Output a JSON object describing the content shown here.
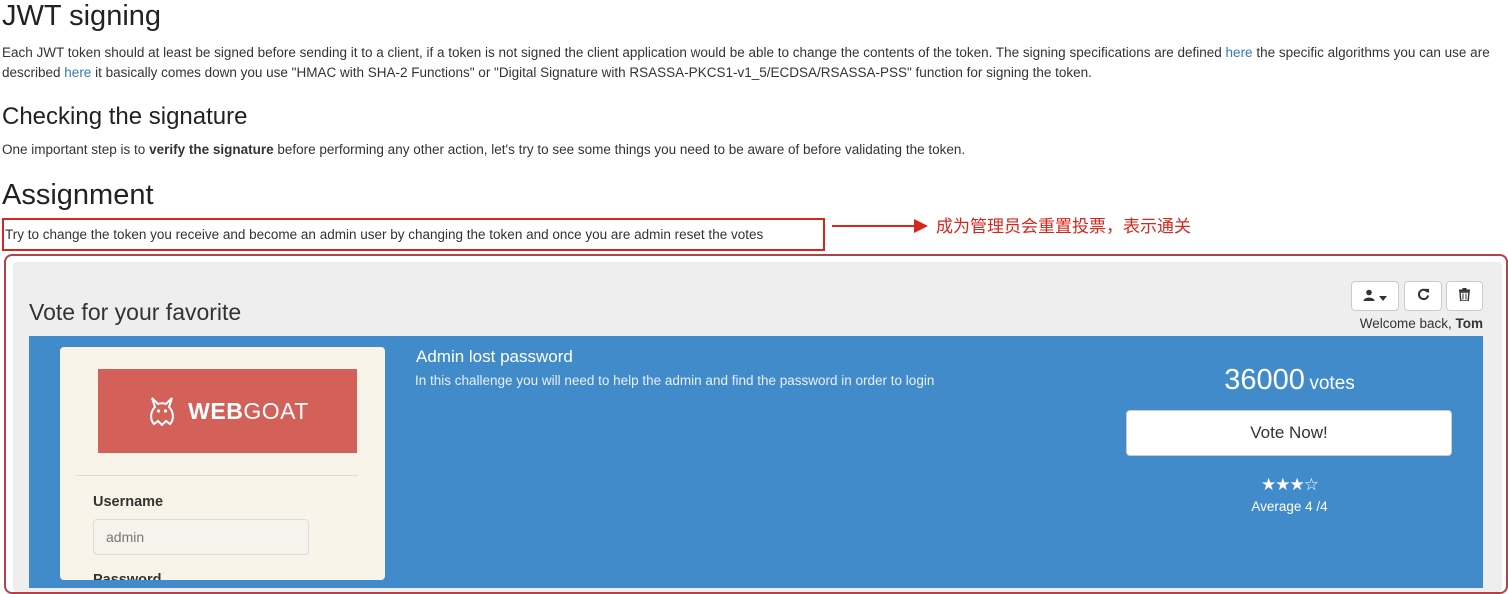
{
  "sections": {
    "jwt_title": "JWT signing",
    "jwt_para_1": "Each JWT token should at least be signed before sending it to a client, if a token is not signed the client application would be able to change the contents of the token. The signing specifications are defined ",
    "jwt_link_1": "here",
    "jwt_para_2": " the specific algorithms you can use are described ",
    "jwt_link_2": "here",
    "jwt_para_3": " it basically comes down you use \"HMAC with SHA-2 Functions\" or \"Digital Signature with RSASSA-PKCS1-v1_5/ECDSA/RSASSA-PSS\" function for signing the token.",
    "check_title": "Checking the signature",
    "check_para_1": "One important step is to ",
    "check_bold": "verify the signature",
    "check_para_2": " before performing any other action, let's try to see some things you need to be aware of before validating the token.",
    "assign_title": "Assignment",
    "assign_text": "Try to change the token you receive and become an admin user by changing the token and once you are admin reset the votes"
  },
  "annotation": {
    "text": "成为管理员会重置投票，表示通关",
    "color": "#d9261c"
  },
  "vote_panel": {
    "title": "Vote for your favorite",
    "welcome_prefix": "Welcome back, ",
    "user": "Tom",
    "buttons": {
      "user_icon": "user-icon",
      "refresh_icon": "refresh-icon",
      "delete_icon": "trash-icon"
    },
    "card": {
      "logo_bold": "WEB",
      "logo_rest": "GOAT",
      "username_label": "Username",
      "username_value": "admin",
      "password_label": "Password"
    },
    "challenge": {
      "title": "Admin lost password",
      "description": "In this challenge you will need to help the admin and find the password in order to login",
      "votes": "36000",
      "votes_unit": "votes",
      "vote_button": "Vote Now!",
      "stars": "★★★☆",
      "rating": 3,
      "average": "Average 4 /4"
    },
    "colors": {
      "blue_bg": "#428bca",
      "logo_bg": "#d4605a"
    }
  }
}
